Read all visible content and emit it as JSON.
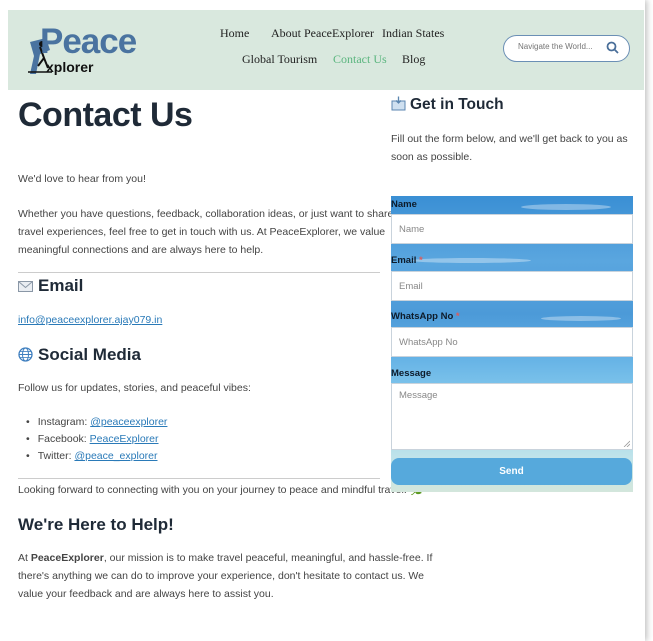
{
  "logo": {
    "word1": "Peace",
    "word2": "xplorer"
  },
  "nav": {
    "home": "Home",
    "about": "About PeaceExplorer",
    "states": "Indian States",
    "global": "Global Tourism",
    "contact": "Contact Us",
    "blog": "Blog"
  },
  "search": {
    "placeholder": "Navigate the World..."
  },
  "main": {
    "title": "Contact Us",
    "intro": "We'd love to hear from you!",
    "body_line1": "Whether you have questions, feedback, collaboration ideas, or just want to share your",
    "body_line2": "travel experiences, feel free to get in touch with us. At PeaceExplorer, we value",
    "body_line3": "meaningful connections and are always here to help.",
    "email_heading": "Email",
    "email_address": "info@peaceexplorer.ajay079.in",
    "social_heading": "Social Media",
    "social_intro": "Follow us for updates, stories, and peaceful vibes:",
    "social": [
      {
        "label": "Instagram: ",
        "link": "@peaceexplorer"
      },
      {
        "label": "Facebook: ",
        "link": "PeaceExplorer"
      },
      {
        "label": "Twitter: ",
        "link": "@peace_explorer"
      }
    ],
    "closing": "Looking forward to connecting with you on your journey to peace and mindful travel! 🌿",
    "help_heading": "We're Here to Help!",
    "help_prefix": "At ",
    "help_brand": "PeaceExplorer",
    "help_line1_rest": ", our mission is to make travel peaceful, meaningful, and hassle-free. If",
    "help_line2": "there's anything we can do to improve your experience, don't hesitate to contact us. We",
    "help_line3": "value your feedback and are always here to assist you."
  },
  "sidebar": {
    "title": "Get in Touch",
    "desc": "Fill out the form below, and we'll get back to you as soon as possible.",
    "form": {
      "name_label": "Name",
      "name_placeholder": "Name",
      "email_label": "Email",
      "email_placeholder": "Email",
      "whatsapp_label": "WhatsApp No",
      "whatsapp_placeholder": "WhatsApp No",
      "message_label": "Message",
      "message_placeholder": "Message",
      "required_mark": "*",
      "send_label": "Send"
    }
  }
}
